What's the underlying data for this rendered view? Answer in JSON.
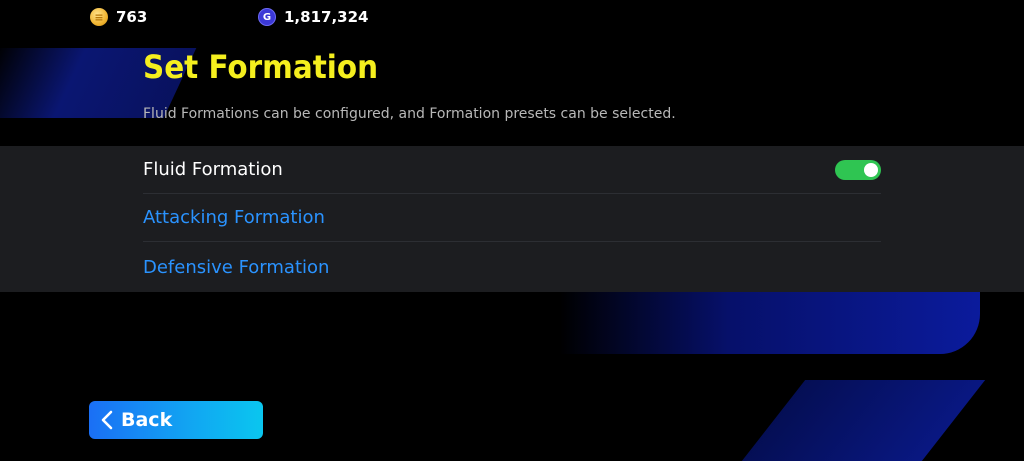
{
  "currency": {
    "coins_icon": "efootball-coin-icon",
    "coins_value": "763",
    "gp_icon": "gp-coin-icon",
    "gp_value": "1,817,324"
  },
  "header": {
    "title": "Set Formation",
    "subtitle": "Fluid Formations can be configured, and Formation presets can be selected."
  },
  "settings": {
    "items": [
      {
        "label": "Fluid Formation",
        "toggle_state": "on"
      },
      {
        "label": "Attacking Formation"
      },
      {
        "label": "Defensive Formation"
      }
    ]
  },
  "footer": {
    "back_label": "Back"
  },
  "colors": {
    "title": "#f5ef1e",
    "link": "#2a93ff",
    "toggle_on": "#2fc552",
    "back_button": "#11a7f2"
  }
}
